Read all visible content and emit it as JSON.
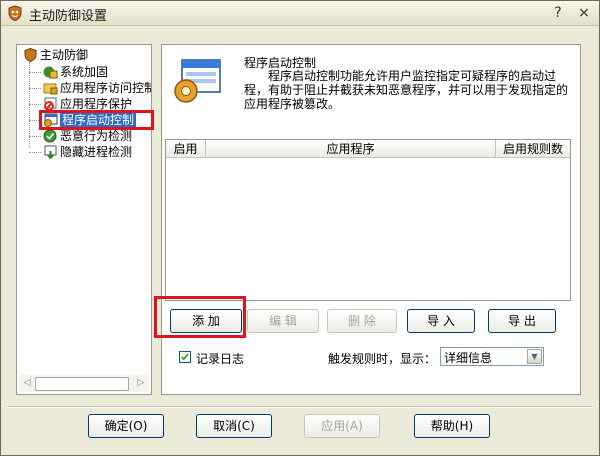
{
  "window": {
    "title": "主动防御设置",
    "controls": {
      "help": "?",
      "close": "×"
    }
  },
  "tree": {
    "root": {
      "label": "主动防御"
    },
    "items": [
      {
        "label": "系统加固",
        "icon": "shield-lock-icon"
      },
      {
        "label": "应用程序访问控制",
        "icon": "folder-lock-icon"
      },
      {
        "label": "应用程序保护",
        "icon": "no-entry-window-icon"
      },
      {
        "label": "程序启动控制",
        "icon": "window-start-icon"
      },
      {
        "label": "恶意行为检测",
        "icon": "globe-check-icon"
      },
      {
        "label": "隐藏进程检测",
        "icon": "window-down-arrow-icon"
      }
    ],
    "selected_index": 3
  },
  "detail": {
    "title": "程序启动控制",
    "description": "程序启动控制功能允许用户监控指定可疑程序的启动过程，有助于阻止并截获未知恶意程序，并可以用于发现指定的应用程序被篡改。",
    "table": {
      "columns": [
        "启用",
        "应用程序",
        "启用规则数"
      ],
      "rows": []
    },
    "buttons": {
      "add": "添 加",
      "edit": "编 辑",
      "delete": "删 除",
      "import": "导 入",
      "export": "导 出"
    },
    "log_checkbox": {
      "label": "记录日志",
      "checked": true
    },
    "display_label": "触发规则时，显示：",
    "display_select": {
      "value": "详细信息"
    }
  },
  "footer": {
    "ok": "确定(O)",
    "cancel": "取消(C)",
    "apply": "应用(A)",
    "help": "帮助(H)"
  }
}
